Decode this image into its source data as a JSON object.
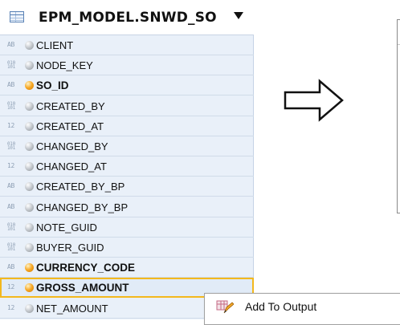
{
  "panel": {
    "title": "EPM_MODEL.SNWD_SO",
    "columns": [
      {
        "name": "CLIENT",
        "type": "AB",
        "key": false
      },
      {
        "name": "NODE_KEY",
        "type": "010\n101",
        "key": false
      },
      {
        "name": "SO_ID",
        "type": "AB",
        "key": true
      },
      {
        "name": "CREATED_BY",
        "type": "010\n101",
        "key": false
      },
      {
        "name": "CREATED_AT",
        "type": "12",
        "key": false
      },
      {
        "name": "CHANGED_BY",
        "type": "010\n101",
        "key": false
      },
      {
        "name": "CHANGED_AT",
        "type": "12",
        "key": false
      },
      {
        "name": "CREATED_BY_BP",
        "type": "AB",
        "key": false
      },
      {
        "name": "CHANGED_BY_BP",
        "type": "AB",
        "key": false
      },
      {
        "name": "NOTE_GUID",
        "type": "010\n101",
        "key": false
      },
      {
        "name": "BUYER_GUID",
        "type": "010\n101",
        "key": false
      },
      {
        "name": "CURRENCY_CODE",
        "type": "AB",
        "key": true
      },
      {
        "name": "GROSS_AMOUNT",
        "type": "12",
        "key": true,
        "selected": true
      },
      {
        "name": "NET_AMOUNT",
        "type": "12",
        "key": false
      }
    ]
  },
  "context_menu": {
    "items": [
      {
        "label": "Add To Output",
        "icon": "add-to-output-icon"
      }
    ]
  },
  "colors": {
    "panel_bg": "#e9f0f9",
    "selection_border": "#f3b81d",
    "key_dot": "#f6a623"
  }
}
